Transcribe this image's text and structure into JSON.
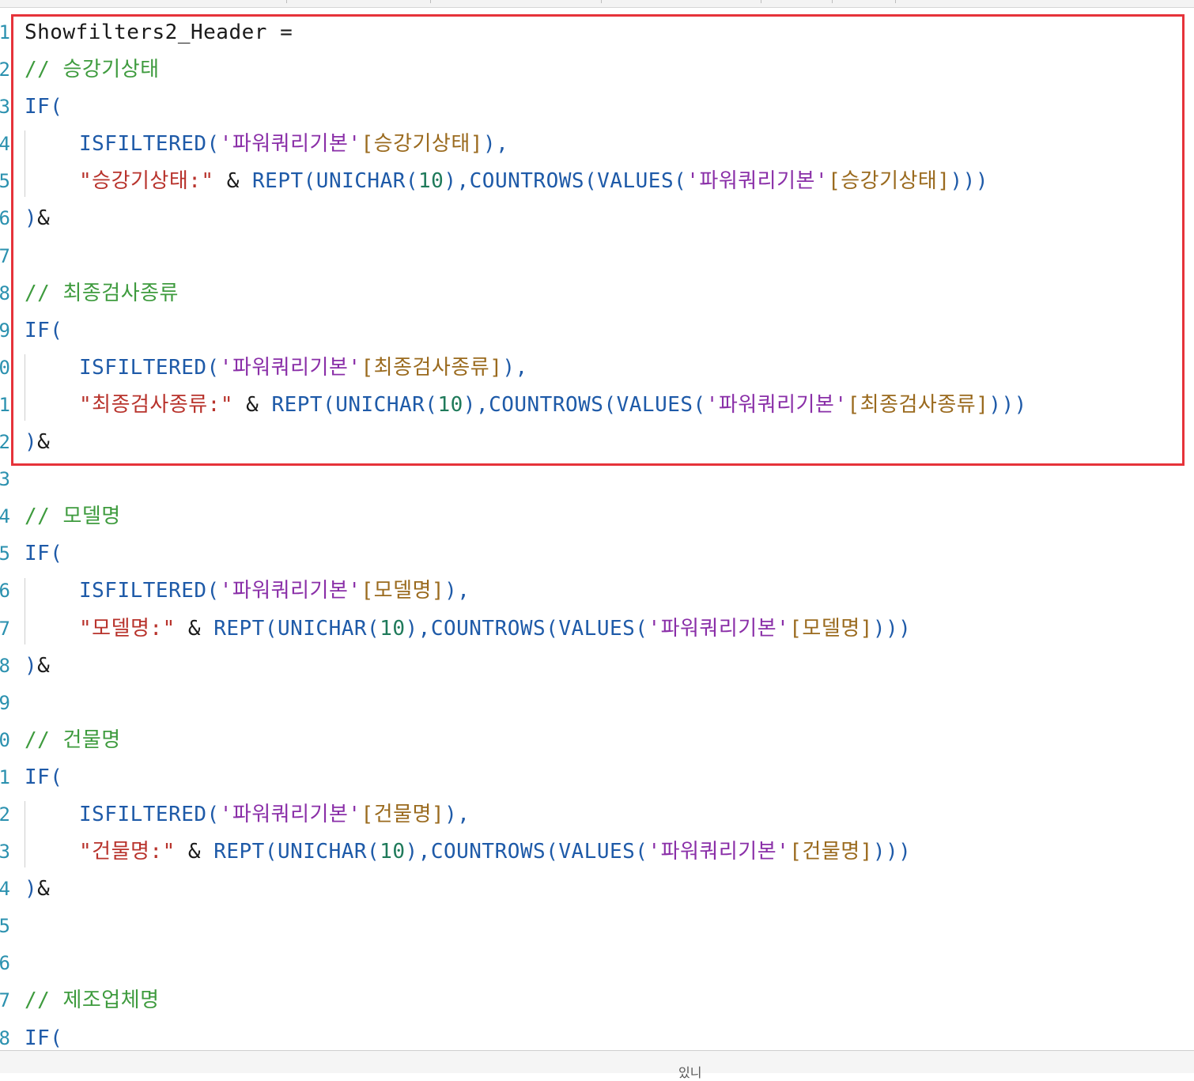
{
  "editor": {
    "lines": [
      {
        "num": "1",
        "tokens": [
          {
            "t": "Showfilters2_Header =",
            "c": "plain"
          }
        ]
      },
      {
        "num": "2",
        "tokens": [
          {
            "t": "// 승강기상태",
            "c": "comment"
          }
        ]
      },
      {
        "num": "3",
        "tokens": [
          {
            "t": "IF(",
            "c": "kw"
          }
        ]
      },
      {
        "num": "4",
        "indent": true,
        "tokens": [
          {
            "t": "ISFILTERED(",
            "c": "kw"
          },
          {
            "t": "'파워쿼리기본'",
            "c": "p2"
          },
          {
            "t": "[승강기상태]",
            "c": "br"
          },
          {
            "t": "),",
            "c": "kw"
          }
        ]
      },
      {
        "num": "5",
        "indent": true,
        "tokens": [
          {
            "t": "\"승강기상태:\"",
            "c": "str"
          },
          {
            "t": " & ",
            "c": "plain"
          },
          {
            "t": "REPT(UNICHAR(",
            "c": "kw"
          },
          {
            "t": "10",
            "c": "num"
          },
          {
            "t": "),COUNTROWS(VALUES(",
            "c": "kw"
          },
          {
            "t": "'파워쿼리기본'",
            "c": "p2"
          },
          {
            "t": "[승강기상태]",
            "c": "br"
          },
          {
            "t": ")))",
            "c": "kw"
          }
        ]
      },
      {
        "num": "6",
        "tokens": [
          {
            "t": ")",
            "c": "kw"
          },
          {
            "t": "&",
            "c": "plain"
          }
        ]
      },
      {
        "num": "7",
        "tokens": []
      },
      {
        "num": "8",
        "tokens": [
          {
            "t": "// 최종검사종류",
            "c": "comment"
          }
        ]
      },
      {
        "num": "9",
        "tokens": [
          {
            "t": "IF(",
            "c": "kw"
          }
        ]
      },
      {
        "num": "0",
        "indent": true,
        "tokens": [
          {
            "t": "ISFILTERED(",
            "c": "kw"
          },
          {
            "t": "'파워쿼리기본'",
            "c": "p2"
          },
          {
            "t": "[최종검사종류]",
            "c": "br"
          },
          {
            "t": "),",
            "c": "kw"
          }
        ]
      },
      {
        "num": "1",
        "indent": true,
        "tokens": [
          {
            "t": "\"최종검사종류:\"",
            "c": "str"
          },
          {
            "t": " & ",
            "c": "plain"
          },
          {
            "t": "REPT(UNICHAR(",
            "c": "kw"
          },
          {
            "t": "10",
            "c": "num"
          },
          {
            "t": "),COUNTROWS(VALUES(",
            "c": "kw"
          },
          {
            "t": "'파워쿼리기본'",
            "c": "p2"
          },
          {
            "t": "[최종검사종류]",
            "c": "br"
          },
          {
            "t": ")))",
            "c": "kw"
          }
        ]
      },
      {
        "num": "2",
        "tokens": [
          {
            "t": ")",
            "c": "kw"
          },
          {
            "t": "&",
            "c": "plain"
          }
        ]
      },
      {
        "num": "3",
        "tokens": []
      },
      {
        "num": "4",
        "tokens": [
          {
            "t": "// 모델명",
            "c": "comment"
          }
        ]
      },
      {
        "num": "5",
        "tokens": [
          {
            "t": "IF(",
            "c": "kw"
          }
        ]
      },
      {
        "num": "6",
        "indent": true,
        "tokens": [
          {
            "t": "ISFILTERED(",
            "c": "kw"
          },
          {
            "t": "'파워쿼리기본'",
            "c": "p2"
          },
          {
            "t": "[모델명]",
            "c": "br"
          },
          {
            "t": "),",
            "c": "kw"
          }
        ]
      },
      {
        "num": "7",
        "indent": true,
        "tokens": [
          {
            "t": "\"모델명:\"",
            "c": "str"
          },
          {
            "t": " & ",
            "c": "plain"
          },
          {
            "t": "REPT(UNICHAR(",
            "c": "kw"
          },
          {
            "t": "10",
            "c": "num"
          },
          {
            "t": "),COUNTROWS(VALUES(",
            "c": "kw"
          },
          {
            "t": "'파워쿼리기본'",
            "c": "p2"
          },
          {
            "t": "[모델명]",
            "c": "br"
          },
          {
            "t": ")))",
            "c": "kw"
          }
        ]
      },
      {
        "num": "8",
        "tokens": [
          {
            "t": ")",
            "c": "kw"
          },
          {
            "t": "&",
            "c": "plain"
          }
        ]
      },
      {
        "num": "9",
        "tokens": []
      },
      {
        "num": "0",
        "tokens": [
          {
            "t": "// 건물명",
            "c": "comment"
          }
        ]
      },
      {
        "num": "1",
        "tokens": [
          {
            "t": "IF(",
            "c": "kw"
          }
        ]
      },
      {
        "num": "2",
        "indent": true,
        "tokens": [
          {
            "t": "ISFILTERED(",
            "c": "kw"
          },
          {
            "t": "'파워쿼리기본'",
            "c": "p2"
          },
          {
            "t": "[건물명]",
            "c": "br"
          },
          {
            "t": "),",
            "c": "kw"
          }
        ]
      },
      {
        "num": "3",
        "indent": true,
        "tokens": [
          {
            "t": "\"건물명:\"",
            "c": "str"
          },
          {
            "t": " & ",
            "c": "plain"
          },
          {
            "t": "REPT(UNICHAR(",
            "c": "kw"
          },
          {
            "t": "10",
            "c": "num"
          },
          {
            "t": "),COUNTROWS(VALUES(",
            "c": "kw"
          },
          {
            "t": "'파워쿼리기본'",
            "c": "p2"
          },
          {
            "t": "[건물명]",
            "c": "br"
          },
          {
            "t": ")))",
            "c": "kw"
          }
        ]
      },
      {
        "num": "4",
        "tokens": [
          {
            "t": ")",
            "c": "kw"
          },
          {
            "t": "&",
            "c": "plain"
          }
        ]
      },
      {
        "num": "5",
        "tokens": []
      },
      {
        "num": "6",
        "tokens": []
      },
      {
        "num": "7",
        "tokens": [
          {
            "t": "// 제조업체명",
            "c": "comment"
          }
        ]
      },
      {
        "num": "8",
        "tokens": [
          {
            "t": "IF(",
            "c": "kw"
          }
        ]
      }
    ]
  },
  "bottom_bar": {
    "text": "있니"
  },
  "colors": {
    "highlight_border": "#e6333a",
    "keyword": "#1e5aa8",
    "comment": "#3e9b3e",
    "string": "#b8332c",
    "number": "#1f7a5a",
    "table_ref": "#8a2fa8",
    "column_ref": "#9a6a1e",
    "line_number": "#2b91af"
  }
}
